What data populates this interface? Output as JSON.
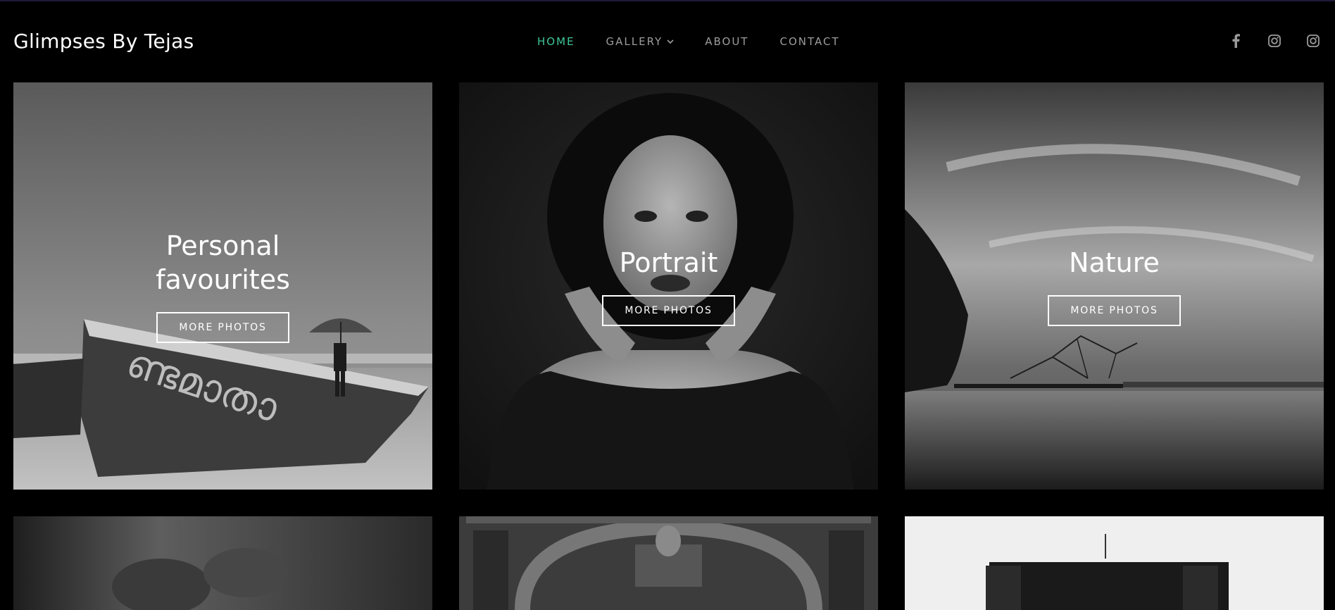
{
  "brand": {
    "title": "Glimpses By Tejas"
  },
  "nav": {
    "home": "HOME",
    "gallery": "GALLERY",
    "about": "ABOUT",
    "contact": "CONTACT"
  },
  "social": {
    "icons": [
      "facebook-icon",
      "instagram-icon",
      "instagram-icon"
    ]
  },
  "colors": {
    "accent": "#3ec79b",
    "background": "#000000",
    "nav_text": "#9c9c9c"
  },
  "cards": [
    {
      "title": "Personal favourites",
      "button": "MORE PHOTOS"
    },
    {
      "title": "Portrait",
      "button": "MORE PHOTOS"
    },
    {
      "title": "Nature",
      "button": "MORE PHOTOS"
    }
  ]
}
